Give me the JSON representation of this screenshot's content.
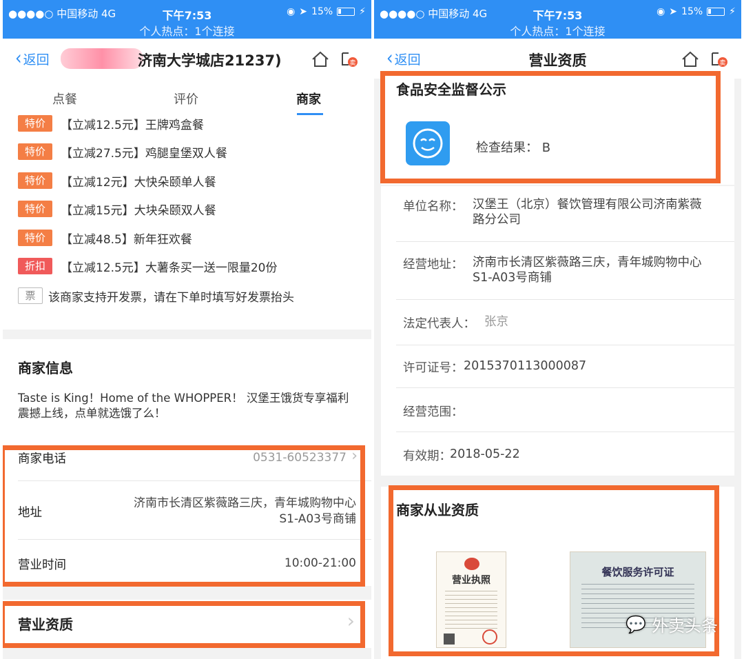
{
  "status": {
    "carrier": "●●●●○ 中国移动  4G",
    "time": "下午7:53",
    "battery": "15%",
    "hotspot": "个人热点：1个连接"
  },
  "left": {
    "back_label": "返回",
    "title": "济南大学城店21237)",
    "tabs": [
      "点餐",
      "评价",
      "商家"
    ],
    "promos": [
      {
        "tag": "特价",
        "text": "【立减12.5元】王牌鸡盒餐"
      },
      {
        "tag": "特价",
        "text": "【立减27.5元】鸡腿皇堡双人餐"
      },
      {
        "tag": "特价",
        "text": "【立减12元】大快朵颐单人餐"
      },
      {
        "tag": "特价",
        "text": "【立减15元】大块朵颐双人餐"
      },
      {
        "tag": "特价",
        "text": "【立减48.5】新年狂欢餐"
      },
      {
        "tag": "折扣",
        "text": "【立减12.5元】大薯条买一送一限量20份"
      }
    ],
    "invoice_tag": "票",
    "invoice_text": "该商家支持开发票，请在下单时填写好发票抬头",
    "merchant_info_title": "商家信息",
    "merchant_desc": "Taste is King！Home of the WHOPPER！ 汉堡王饿货专享福利震撼上线，点单就选饿了么！",
    "phone_label": "商家电话",
    "phone_value": "0531-60523377",
    "address_label": "地址",
    "address_value_1": "济南市长清区紫薇路三庆，青年城购物中心",
    "address_value_2": "S1-A03号商铺",
    "hours_label": "营业时间",
    "hours_value": "10:00-21:00",
    "qualification_label": "营业资质"
  },
  "right": {
    "back_label": "返回",
    "title": "营业资质",
    "food_safety_title": "食品安全监督公示",
    "inspection_result": "检查结果： B",
    "unit_name_label": "单位名称：",
    "unit_name_value": "汉堡王（北京）餐饮管理有限公司济南紫薇路分公司",
    "address_label": "经营地址：",
    "address_value": "济南市长清区紫薇路三庆，青年城购物中心S1-A03号商铺",
    "legal_rep_label": "法定代表人：",
    "legal_rep_value": "张京",
    "license_no_label": "许可证号：",
    "license_no_value": "2015370113000087",
    "scope_label": "经营范围：",
    "scope_value": "",
    "validity_label": "有效期：",
    "validity_value": "2018-05-22",
    "qualification_title": "商家从业资质",
    "license1_title": "营业执照",
    "license2_title": "餐饮服务许可证"
  },
  "watermark": "外卖头条",
  "colors": {
    "brand_blue": "#2f8ff4",
    "highlight_orange": "#f2692f",
    "tag_special": "#f47e45",
    "tag_discount": "#f05a5a"
  }
}
